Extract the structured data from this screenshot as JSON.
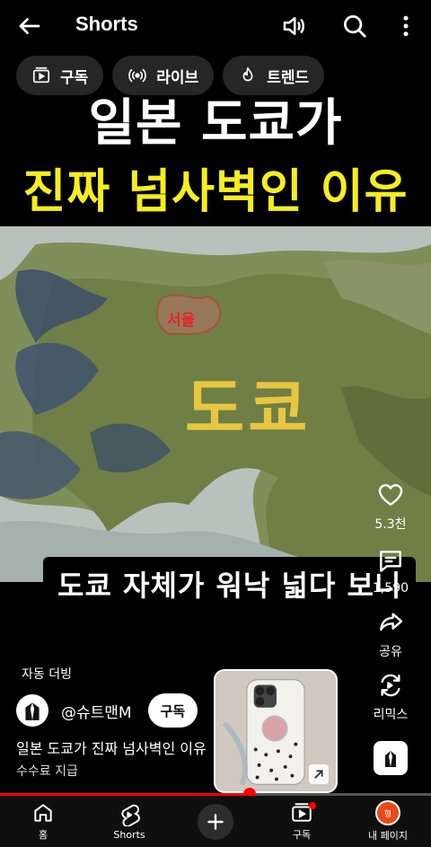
{
  "header": {
    "title": "Shorts"
  },
  "chips": [
    {
      "label": "구독",
      "icon": "subscriptions-icon"
    },
    {
      "label": "라이브",
      "icon": "live-icon"
    },
    {
      "label": "트렌드",
      "icon": "trending-icon"
    }
  ],
  "video": {
    "headline_line1": "일본 도쿄가",
    "headline_line2": "진짜 넘사벽인 이유",
    "map_label_tokyo": "도쿄",
    "map_label_seoul": "서울",
    "caption": "도쿄 자체가 워낙 넓다 보니"
  },
  "actions": {
    "likes": "5.3천",
    "comments": "1,590",
    "share": "공유",
    "remix": "리믹스"
  },
  "info": {
    "auto_dub": "자동 더빙",
    "channel": "@슈트맨M",
    "subscribe": "구독",
    "title": "일본 도쿄가 진짜 넘사벽인 이유",
    "fee_note": "수수료 지급"
  },
  "progress": {
    "fraction": 0.58
  },
  "nav": {
    "home": "홈",
    "shorts": "Shorts",
    "subscriptions": "구독",
    "me": "내 페이지",
    "me_avatar_text": "형"
  },
  "colors": {
    "accent_red": "#ff0000",
    "headline_yellow": "#f5ee1f",
    "tokyo_label": "#e8c640",
    "seoul_label": "#e0262a"
  }
}
